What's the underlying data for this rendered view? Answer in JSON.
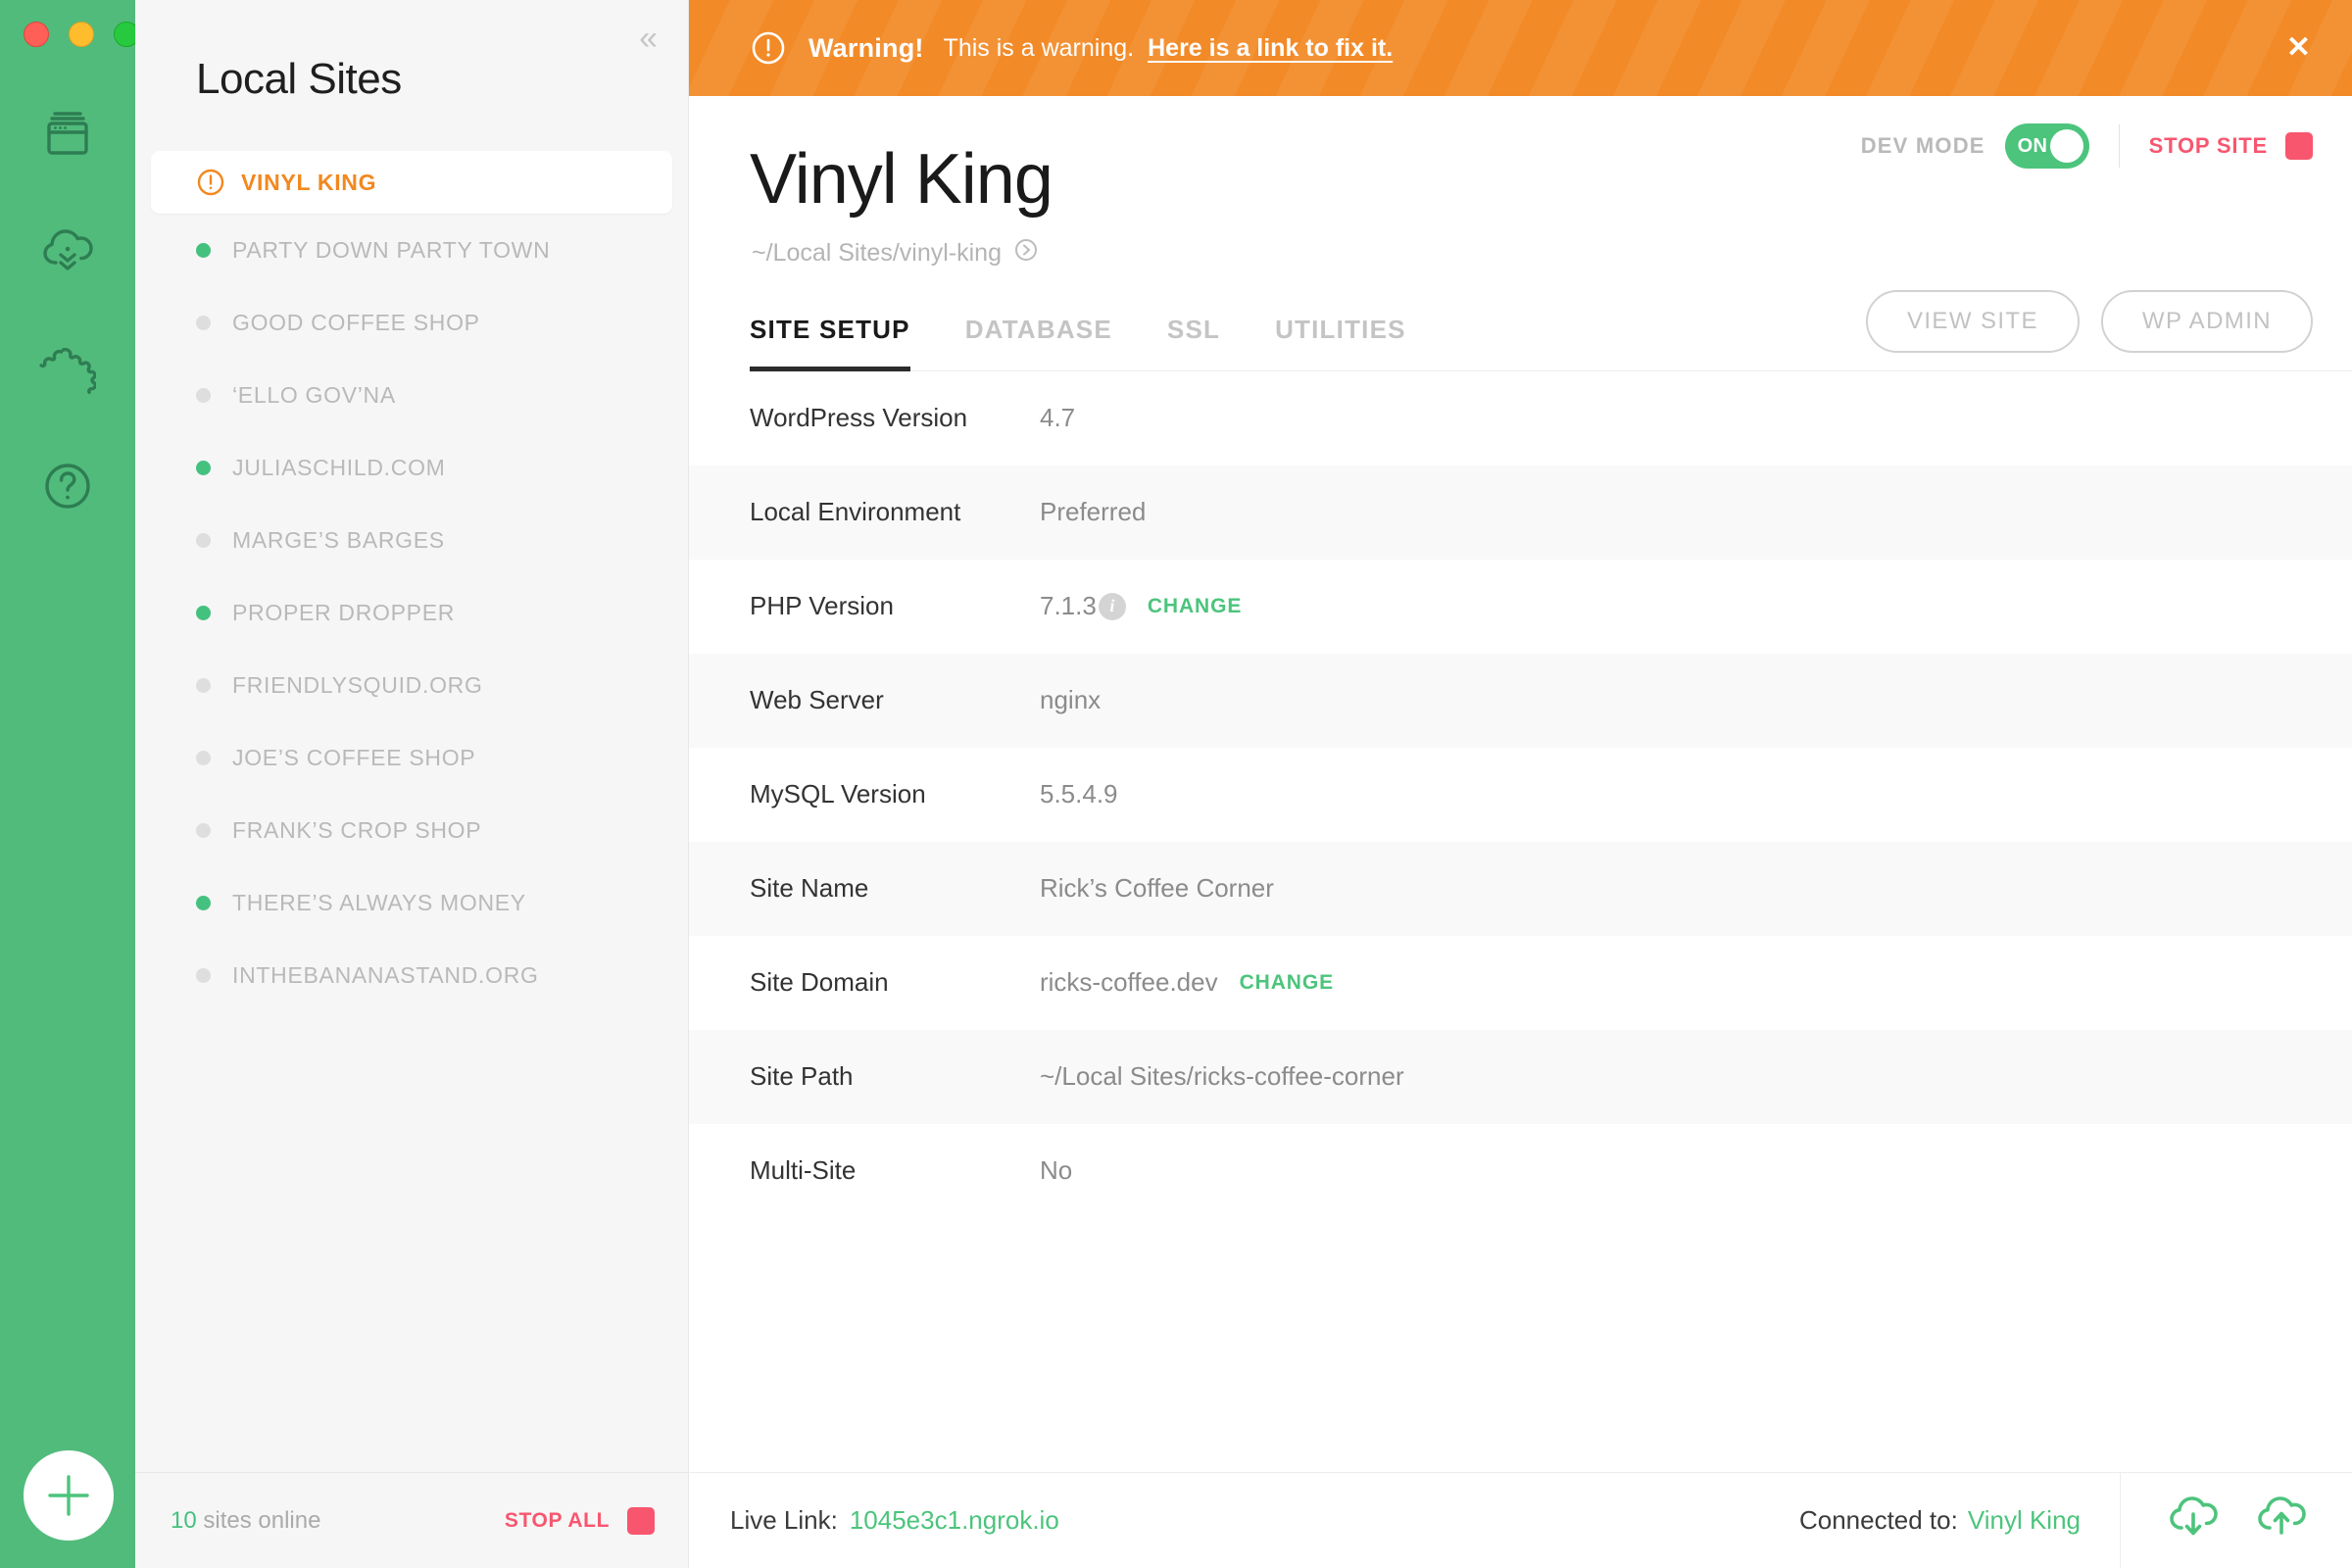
{
  "window": {
    "traffic_lights": [
      "close",
      "minimize",
      "zoom"
    ],
    "colors": {
      "rail_green": "#51bb7b",
      "accent_green": "#4cc47c",
      "warning_orange": "#f28a27",
      "danger_red": "#f8566f",
      "selected_site_orange": "#f2881f"
    }
  },
  "rail": {
    "icons": [
      {
        "name": "sites-icon",
        "label": "Sites"
      },
      {
        "name": "cloud-download-icon",
        "label": "Cloud Backups"
      },
      {
        "name": "puzzle-icon",
        "label": "Add-ons"
      },
      {
        "name": "help-icon",
        "label": "Help"
      }
    ],
    "add_button": {
      "name": "add-site-button",
      "label": "+"
    }
  },
  "sidebar": {
    "title": "Local Sites",
    "collapse_icon": "chevron-double-left-icon",
    "items": [
      {
        "label": "VINYL KING",
        "status": "warning",
        "selected": true
      },
      {
        "label": "PARTY DOWN PARTY TOWN",
        "status": "online",
        "selected": false
      },
      {
        "label": "GOOD COFFEE SHOP",
        "status": "offline",
        "selected": false
      },
      {
        "label": "‘ELLO GOV’NA",
        "status": "offline",
        "selected": false
      },
      {
        "label": "JULIASCHILD.COM",
        "status": "online",
        "selected": false
      },
      {
        "label": "MARGE’S BARGES",
        "status": "offline",
        "selected": false
      },
      {
        "label": "PROPER DROPPER",
        "status": "online",
        "selected": false
      },
      {
        "label": "FRIENDLYSQUID.ORG",
        "status": "offline",
        "selected": false
      },
      {
        "label": "JOE’S COFFEE SHOP",
        "status": "offline",
        "selected": false
      },
      {
        "label": "FRANK’S CROP SHOP",
        "status": "offline",
        "selected": false
      },
      {
        "label": "THERE’S ALWAYS MONEY",
        "status": "online",
        "selected": false
      },
      {
        "label": "INTHEBANANASTAND.ORG",
        "status": "offline",
        "selected": false
      }
    ],
    "footer": {
      "count": "10",
      "count_suffix": " sites online",
      "stop_all_label": "STOP ALL"
    }
  },
  "warning": {
    "icon": "alert-circle-icon",
    "strong": "Warning!",
    "text": "This is a warning.",
    "link": "Here is a link to fix it.",
    "close_label": "✕"
  },
  "site": {
    "dev_mode_label": "DEV MODE",
    "dev_mode_state": "ON",
    "stop_site_label": "STOP SITE",
    "name": "Vinyl King",
    "path": "~/Local Sites/vinyl-king",
    "path_icon": "open-folder-arrow-icon"
  },
  "tabs": [
    {
      "label": "SITE SETUP",
      "active": true
    },
    {
      "label": "DATABASE",
      "active": false
    },
    {
      "label": "SSL",
      "active": false
    },
    {
      "label": "UTILITIES",
      "active": false
    }
  ],
  "actions": {
    "view_site": "VIEW SITE",
    "wp_admin": "WP ADMIN"
  },
  "setup_rows": [
    {
      "label": "WordPress Version",
      "value": "4.7",
      "info": false,
      "change": null
    },
    {
      "label": "Local Environment",
      "value": "Preferred",
      "info": false,
      "change": null
    },
    {
      "label": "PHP Version",
      "value": "7.1.3",
      "info": true,
      "change": "CHANGE"
    },
    {
      "label": "Web Server",
      "value": "nginx",
      "info": false,
      "change": null
    },
    {
      "label": "MySQL Version",
      "value": "5.5.4.9",
      "info": false,
      "change": null
    },
    {
      "label": "Site Name",
      "value": "Rick’s Coffee Corner",
      "info": false,
      "change": null
    },
    {
      "label": "Site Domain",
      "value": "ricks-coffee.dev",
      "info": false,
      "change": "CHANGE"
    },
    {
      "label": "Site Path",
      "value": "~/Local Sites/ricks-coffee-corner",
      "info": false,
      "change": null
    },
    {
      "label": "Multi-Site",
      "value": "No",
      "info": false,
      "change": null
    }
  ],
  "bottom_bar": {
    "live_link_label": "Live Link:",
    "live_link_value": "1045e3c1.ngrok.io",
    "connected_label": "Connected to:",
    "connected_value": "Vinyl King",
    "cloud_download_icon": "cloud-download-icon",
    "cloud_upload_icon": "cloud-upload-icon"
  }
}
